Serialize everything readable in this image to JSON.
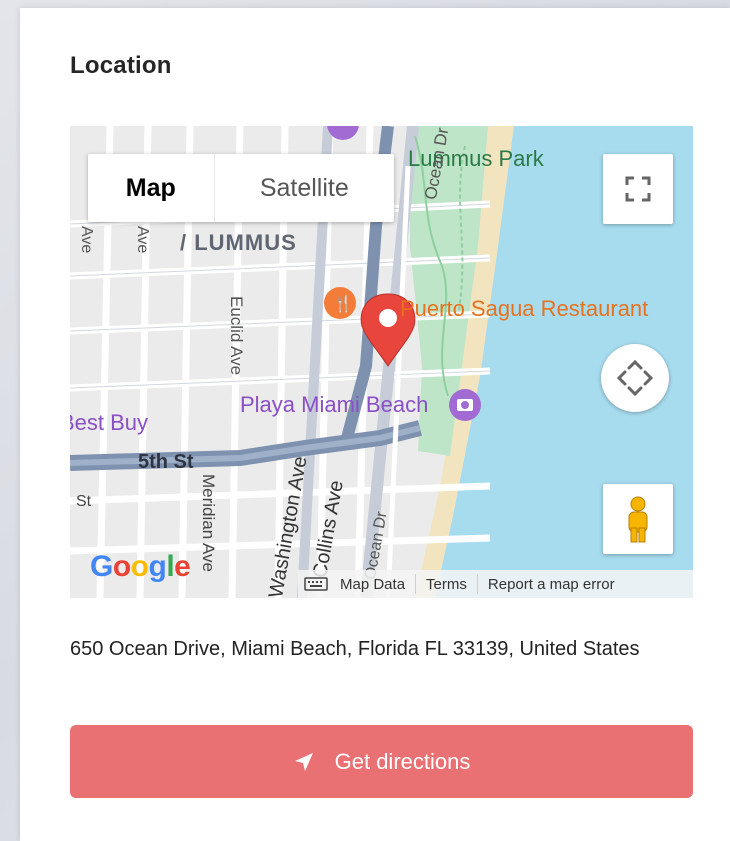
{
  "location": {
    "title": "Location",
    "address": "650 Ocean Drive, Miami Beach, Florida FL 33139, United States",
    "directions_label": "Get directions",
    "directions_color": "#e97073"
  },
  "map": {
    "type_control": {
      "map_label": "Map",
      "satellite_label": "Satellite",
      "selected": "Map"
    },
    "labels": {
      "lummus_park": "Lummus Park",
      "lummus": "/ LUMMUS",
      "ocean_dr": "Ocean Dr",
      "ocean_dr_south": "Ocean Dr",
      "euclid_ave": "Euclid Ave",
      "restaurant": "Puerto Sagua Restaurant",
      "playa": "Playa Miami Beach",
      "best_buy": "Best Buy",
      "fifth_st": "5th St",
      "st": "St",
      "meridian_ave": "Meridian Ave",
      "washington_ave": "Washington Ave",
      "collins_ave": "Collins Ave",
      "ave_1": "Ave",
      "ave_2": "Ave"
    },
    "google_logo": "Google",
    "footer": {
      "map_data": "Map Data",
      "terms": "Terms",
      "report": "Report a map error"
    },
    "colors": {
      "water": "#a7dcef",
      "beach": "#f1e4bf",
      "park": "#bfe5c8",
      "major_road": "#7e92b0",
      "poi_orange": "#f37d38",
      "poi_purple": "#a26bd4",
      "pin": "#e8453c"
    },
    "icons": [
      "fullscreen-icon",
      "pan-compass-icon",
      "pegman-icon",
      "keyboard-icon",
      "restaurant-icon",
      "camera-icon",
      "map-pin-icon",
      "navigation-arrow-icon"
    ]
  }
}
